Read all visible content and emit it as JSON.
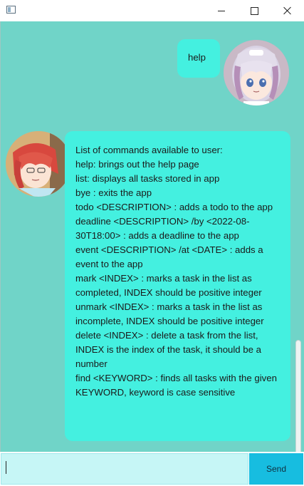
{
  "window": {
    "title": "",
    "icon": "app-window-icon",
    "controls": [
      "minimize-icon",
      "maximize-icon",
      "close-icon"
    ]
  },
  "chat": {
    "background": "#70d4c8",
    "bubble_color": "#44f0e0",
    "messages": [
      {
        "sender": "user",
        "avatar": "anime-girl-white-hair-avatar",
        "text": "help"
      },
      {
        "sender": "bot",
        "avatar": "anime-girl-red-hair-avatar",
        "text": "List of commands available to user:\nhelp: brings out the help page\nlist: displays all tasks stored in app\nbye : exits the app\ntodo <DESCRIPTION> : adds a todo to the app\ndeadline <DESCRIPTION> /by <2022-08-30T18:00> : adds a deadline to the app\nevent <DESCRIPTION> /at <DATE> : adds a event to the app\nmark <INDEX> : marks a task in the list as completed, INDEX should be positive integer\nunmark <INDEX> : marks a task in the list as incomplete, INDEX should be positive integer\ndelete <INDEX> : delete a task from the list, INDEX is the index of the task, it should be a number\nfind <KEYWORD> : finds all tasks with the given KEYWORD, keyword is case sensitive"
      }
    ]
  },
  "input": {
    "value": "",
    "placeholder": ""
  },
  "send_button": {
    "label": "Send",
    "color": "#17bde0"
  }
}
